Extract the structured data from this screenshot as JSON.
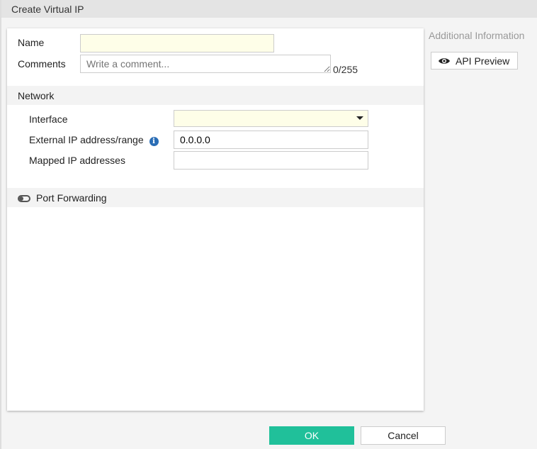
{
  "title": "Create Virtual IP",
  "form": {
    "name_label": "Name",
    "name_value": "",
    "comments_label": "Comments",
    "comments_placeholder": "Write a comment...",
    "comments_count": "0/255",
    "network_section": "Network",
    "interface_label": "Interface",
    "interface_value": "",
    "external_ip_label": "External IP address/range",
    "external_ip_value": "0.0.0.0",
    "mapped_ip_label": "Mapped IP addresses",
    "mapped_ip_value": "",
    "port_forwarding_label": "Port Forwarding",
    "port_forwarding_enabled": false
  },
  "sidebar": {
    "title": "Additional Information",
    "api_preview": "API Preview"
  },
  "footer": {
    "ok": "OK",
    "cancel": "Cancel"
  },
  "colors": {
    "ok": "#20c09a",
    "info": "#2a6db5"
  }
}
